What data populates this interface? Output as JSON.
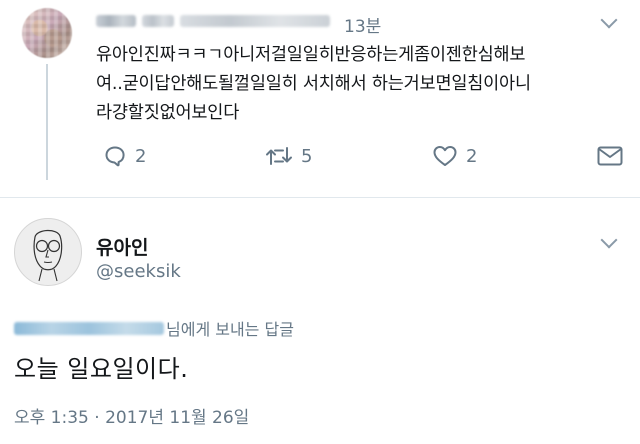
{
  "tweet1": {
    "time_ago": "13분",
    "text": "유아인진짜ㅋㅋㄱ아니저걸일일히반응하는게좀이젠한심해보\n여..굳이답안해도될껄일일히 서치해서 하는거보면일침이아니\n라걍할짓없어보인다",
    "actions": {
      "reply_count": "2",
      "retweet_count": "5",
      "like_count": "2"
    }
  },
  "tweet2": {
    "display_name": "유아인",
    "handle": "@seeksik",
    "reply_to_suffix": "님에게 보내는 답글",
    "text": "오늘 일요일이다.",
    "timestamp": "오후 1:35 · 2017년 11월 26일"
  },
  "icons": {
    "reply": "reply-icon",
    "retweet": "retweet-icon",
    "like": "heart-icon",
    "dm": "envelope-icon",
    "menu": "chevron-down-icon"
  },
  "colors": {
    "primary_text": "#14171a",
    "secondary_text": "#657786",
    "divider": "#e1e8ed"
  }
}
